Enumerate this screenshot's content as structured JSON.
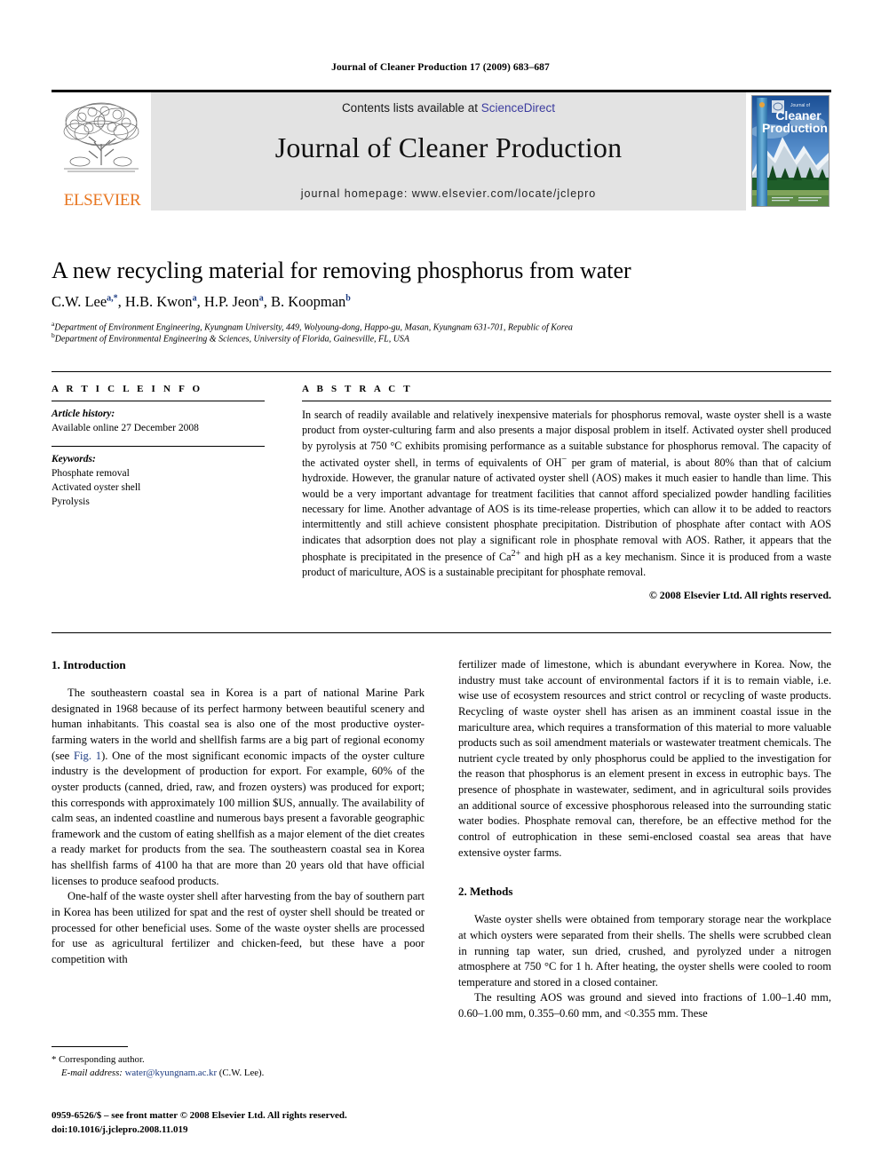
{
  "running_head": "Journal of Cleaner Production 17 (2009) 683–687",
  "masthead": {
    "elsevier_wordmark": "ELSEVIER",
    "contents_prefix": "Contents lists available at ",
    "contents_link": "ScienceDirect",
    "journal_name": "Journal of Cleaner Production",
    "homepage": "journal homepage: www.elsevier.com/locate/jclepro",
    "cover_title_small": "Journal of",
    "cover_title_line1": "Cleaner",
    "cover_title_line2": "Production",
    "link_color": "#3b3b9e",
    "banner_bg": "#e3e3e3",
    "elsevier_orange": "#E87722"
  },
  "article": {
    "title": "A new recycling material for removing phosphorus from water",
    "authors": [
      {
        "name": "C.W. Lee",
        "marks": "a,*"
      },
      {
        "name": "H.B. Kwon",
        "marks": "a"
      },
      {
        "name": "H.P. Jeon",
        "marks": "a"
      },
      {
        "name": "B. Koopman",
        "marks": "b"
      }
    ],
    "affiliations": [
      {
        "mark": "a",
        "text": "Department of Environment Engineering, Kyungnam University, 449, Wolyoung-dong, Happo-gu, Masan, Kyungnam 631-701, Republic of Korea"
      },
      {
        "mark": "b",
        "text": "Department of Environmental Engineering & Sciences, University of Florida, Gainesville, FL, USA"
      }
    ]
  },
  "article_info": {
    "heading": "A R T I C L E  I N F O",
    "history_label": "Article history:",
    "history_value": "Available online 27 December 2008",
    "keywords_label": "Keywords:",
    "keywords": [
      "Phosphate removal",
      "Activated oyster shell",
      "Pyrolysis"
    ]
  },
  "abstract": {
    "heading": "A B S T R A C T",
    "part1": "In search of readily available and relatively inexpensive materials for phosphorus removal, waste oyster shell is a waste product from oyster-culturing farm and also presents a major disposal problem in itself. Activated oyster shell produced by pyrolysis at 750 °C exhibits promising performance as a suitable substance for phosphorus removal. The capacity of the activated oyster shell, in terms of equivalents of OH",
    "sup1": "−",
    "part2": " per gram of material, is about 80% than that of calcium hydroxide. However, the granular nature of activated oyster shell (AOS) makes it much easier to handle than lime. This would be a very important advantage for treatment facilities that cannot afford specialized powder handling facilities necessary for lime. Another advantage of AOS is its time-release properties, which can allow it to be added to reactors intermittently and still achieve consistent phosphate precipitation. Distribution of phosphate after contact with AOS indicates that adsorption does not play a significant role in phosphate removal with AOS. Rather, it appears that the phosphate is precipitated in the presence of Ca",
    "sup2": "2+",
    "part3": " and high pH as a key mechanism. Since it is produced from a waste product of mariculture, AOS is a sustainable precipitant for phosphate removal.",
    "copyright": "© 2008 Elsevier Ltd. All rights reserved."
  },
  "body": {
    "intro_heading": "1.  Introduction",
    "intro_p1_a": "The southeastern coastal sea in Korea is a part of national Marine Park designated in 1968 because of its perfect harmony between beautiful scenery and human inhabitants. This coastal sea is also one of the most productive oyster-farming waters in the world and shellfish farms are a big part of regional economy (see ",
    "intro_p1_xref": "Fig. 1",
    "intro_p1_b": "). One of the most significant economic impacts of the oyster culture industry is the development of production for export. For example, 60% of the oyster products (canned, dried, raw, and frozen oysters) was produced for export; this corresponds with approximately 100 million $US, annually. The availability of calm seas, an indented coastline and numerous bays present a favorable geographic framework and the custom of eating shellfish as a major element of the diet creates a ready market for products from the sea. The southeastern coastal sea in Korea has shellfish farms of 4100 ha that are more than 20 years old that have official licenses to produce seafood products.",
    "intro_p2": "One-half of the waste oyster shell after harvesting from the bay of southern part in Korea has been utilized for spat and the rest of oyster shell should be treated or processed for other beneficial uses. Some of the waste oyster shells are processed for use as agricultural fertilizer and chicken-feed, but these have a poor competition with",
    "intro_p3": "fertilizer made of limestone, which is abundant everywhere in Korea. Now, the industry must take account of environmental factors if it is to remain viable, i.e. wise use of ecosystem resources and strict control or recycling of waste products. Recycling of waste oyster shell has arisen as an imminent coastal issue in the mariculture area, which requires a transformation of this material to more valuable products such as soil amendment materials or wastewater treatment chemicals. The nutrient cycle treated by only phosphorus could be applied to the investigation for the reason that phosphorus is an element present in excess in eutrophic bays. The presence of phosphate in wastewater, sediment, and in agricultural soils provides an additional source of excessive phosphorous released into the surrounding static water bodies. Phosphate removal can, therefore, be an effective method for the control of eutrophication in these semi-enclosed coastal sea areas that have extensive oyster farms.",
    "methods_heading": "2.  Methods",
    "methods_p1": "Waste oyster shells were obtained from temporary storage near the workplace at which oysters were separated from their shells. The shells were scrubbed clean in running tap water, sun dried, crushed, and pyrolyzed under a nitrogen atmosphere at 750 °C for 1 h. After heating, the oyster shells were cooled to room temperature and stored in a closed container.",
    "methods_p2": "The resulting AOS was ground and sieved into fractions of 1.00–1.40 mm, 0.60–1.00 mm, 0.355–0.60 mm, and <0.355 mm. These"
  },
  "footnote": {
    "corresponding": "* Corresponding author.",
    "email_label": "E-mail address:",
    "email": "water@kyungnam.ac.kr",
    "email_suffix": " (C.W. Lee)."
  },
  "imprint": {
    "line1": "0959-6526/$ – see front matter © 2008 Elsevier Ltd. All rights reserved.",
    "line2": "doi:10.1016/j.jclepro.2008.11.019"
  }
}
